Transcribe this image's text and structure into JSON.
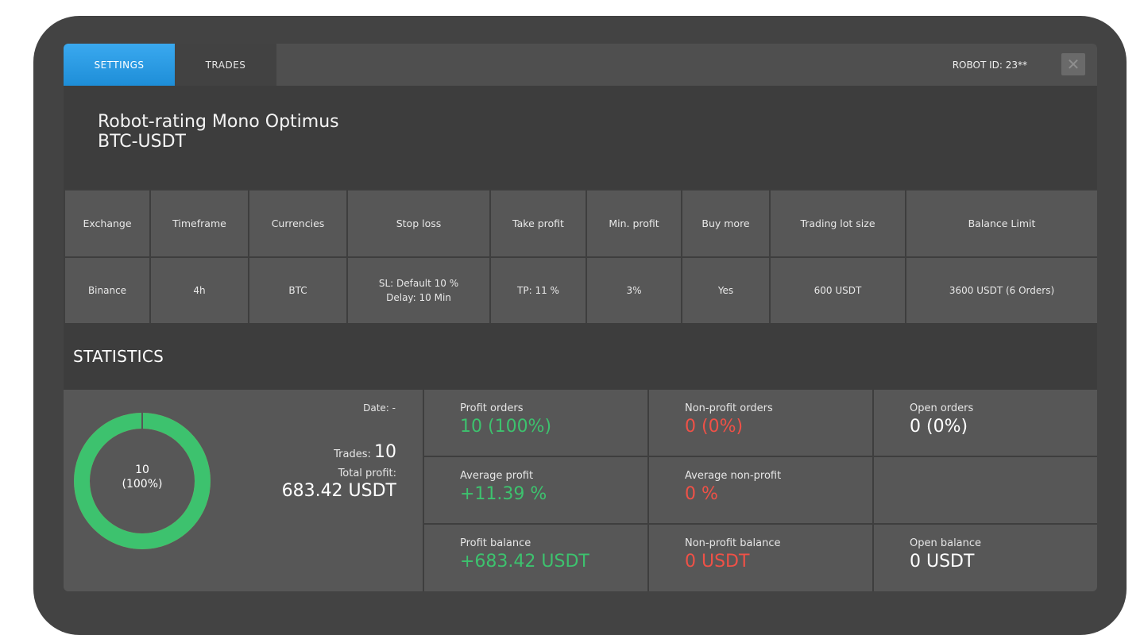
{
  "tabs": {
    "settings": "SETTINGS",
    "trades": "TRADES"
  },
  "robot_id": "ROBOT ID: 23**",
  "close_glyph": "✕",
  "robot": {
    "name": "Robot-rating Mono Optimus",
    "pair": "BTC-USDT"
  },
  "settings_table": {
    "headers": [
      "Exchange",
      "Timeframe",
      "Currencies",
      "Stop loss",
      "Take profit",
      "Min. profit",
      "Buy more",
      "Trading lot size",
      "Balance Limit"
    ],
    "row": {
      "exchange": "Binance",
      "timeframe": "4h",
      "currencies": "BTC",
      "stop_loss_line1": "SL: Default 10 %",
      "stop_loss_line2": "Delay: 10 Min",
      "take_profit": "TP: 11 %",
      "min_profit": "3%",
      "buy_more": "Yes",
      "trading_lot_size": "600 USDT",
      "balance_limit": "3600 USDT (6 Orders)"
    }
  },
  "statistics": {
    "title": "STATISTICS",
    "donut": {
      "value": "10",
      "percent": "(100%)",
      "profit_fraction": 1.0,
      "color": "#3dc26e"
    },
    "date": "Date: -",
    "trades_label": "Trades:",
    "trades_value": "10",
    "total_profit_label": "Total profit:",
    "total_profit_value": "683.42 USDT",
    "cells": {
      "profit_orders": {
        "label": "Profit orders",
        "value": "10 (100%)"
      },
      "non_profit_orders": {
        "label": "Non-profit orders",
        "value": "0 (0%)"
      },
      "open_orders": {
        "label": "Open orders",
        "value": "0 (0%)"
      },
      "average_profit": {
        "label": "Average profit",
        "value": "+11.39 %"
      },
      "average_non_profit": {
        "label": "Average non-profit",
        "value": "0 %"
      },
      "profit_balance": {
        "label": "Profit balance",
        "value": "+683.42 USDT"
      },
      "non_profit_balance": {
        "label": "Non-profit balance",
        "value": "0 USDT"
      },
      "open_balance": {
        "label": "Open balance",
        "value": "0 USDT"
      }
    }
  },
  "colors": {
    "accent": "#2a9be4",
    "profit": "#3dc26e",
    "loss": "#ef5147"
  }
}
